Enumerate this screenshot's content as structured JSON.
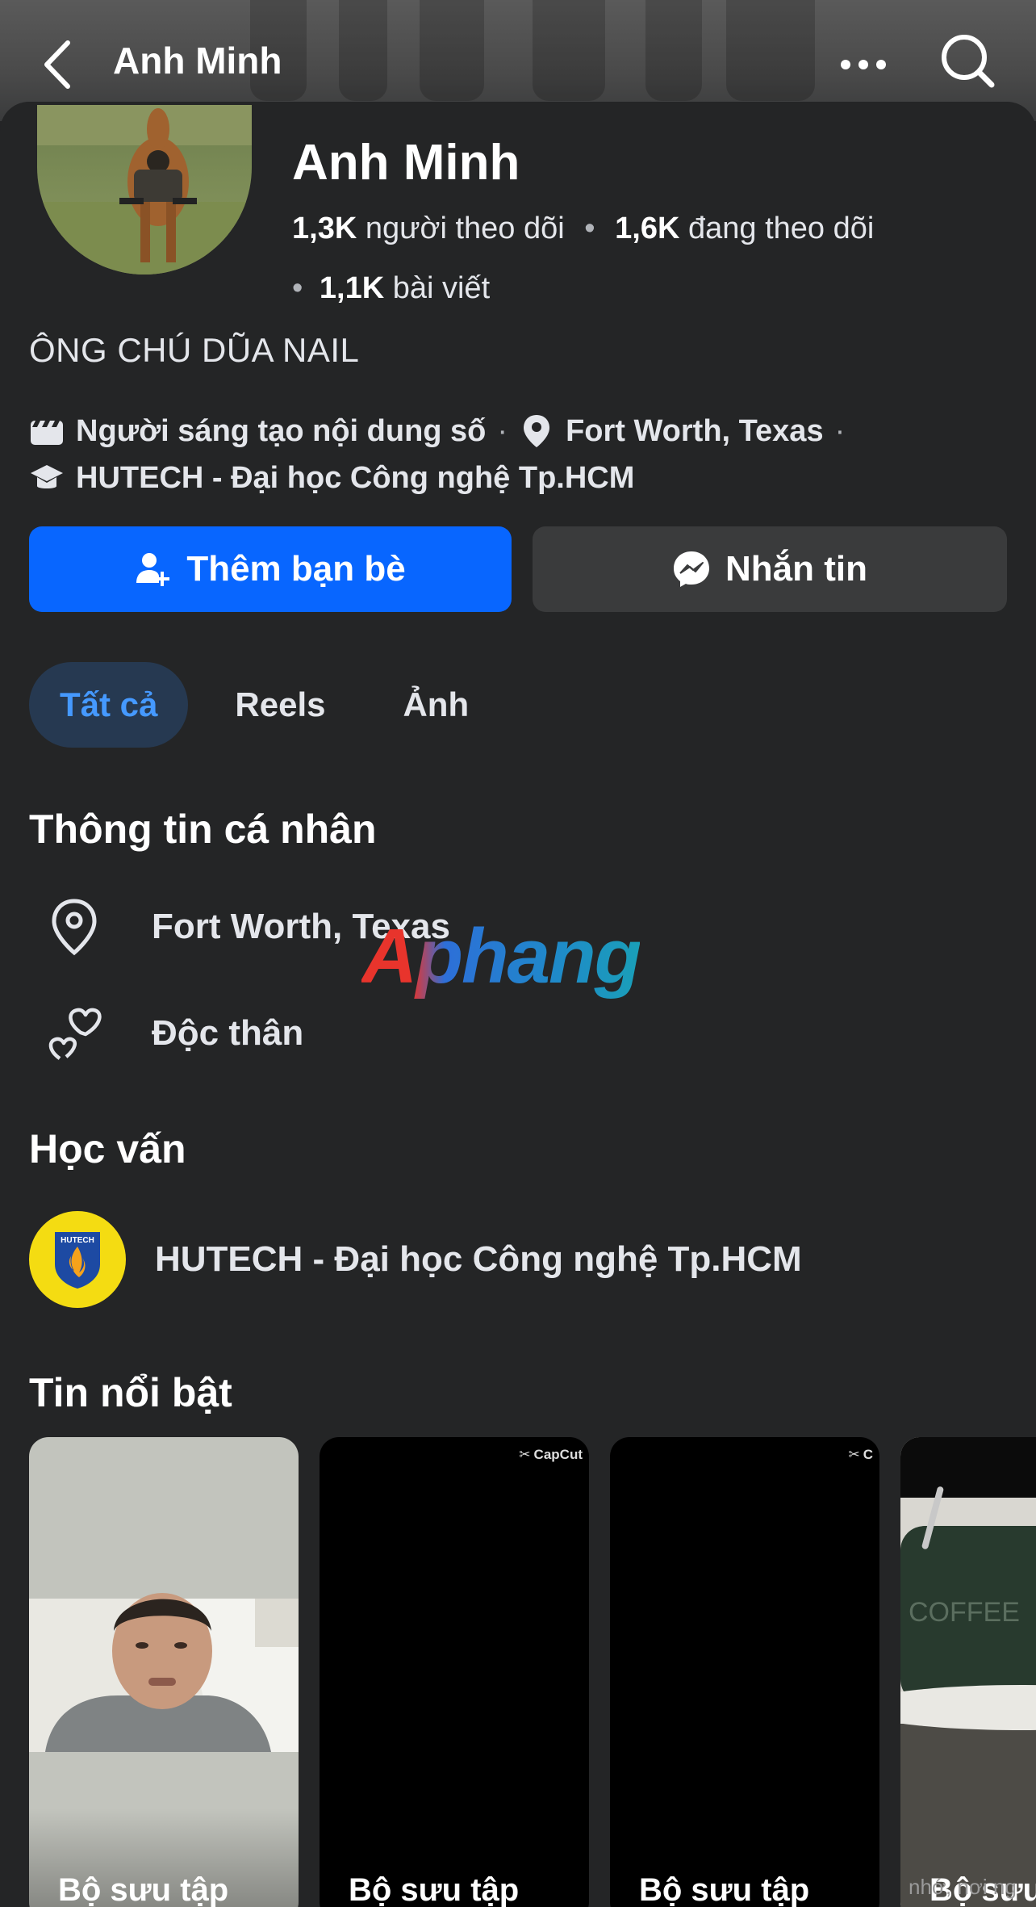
{
  "header": {
    "title": "Anh Minh",
    "back_icon": "chevron-left-icon",
    "more_icon": "more-horizontal-icon",
    "search_icon": "search-icon"
  },
  "profile": {
    "name": "Anh Minh",
    "followers_count": "1,3K",
    "followers_label": "người theo dõi",
    "following_count": "1,6K",
    "following_label": "đang theo dõi",
    "posts_count": "1,1K",
    "posts_label": "bài viết",
    "bio": "ÔNG CHÚ DŨA NAIL",
    "category": "Người sáng tạo nội dung số",
    "location": "Fort Worth, Texas",
    "school": "HUTECH - Đại học Công nghệ Tp.HCM"
  },
  "actions": {
    "add_friend_label": "Thêm bạn bè",
    "message_label": "Nhắn tin"
  },
  "tabs": [
    {
      "label": "Tất cả",
      "active": true
    },
    {
      "label": "Reels",
      "active": false
    },
    {
      "label": "Ảnh",
      "active": false
    }
  ],
  "personal_info": {
    "title": "Thông tin cá nhân",
    "location": "Fort Worth, Texas",
    "relationship": "Độc thân"
  },
  "education": {
    "title": "Học vấn",
    "school": "HUTECH - Đại học Công nghệ Tp.HCM",
    "logo_text": "HUTECH"
  },
  "highlights": {
    "title": "Tin nổi bật",
    "items": [
      {
        "label": "Bộ sưu tập"
      },
      {
        "label": "Bộ sưu tập",
        "badge": "CapCut"
      },
      {
        "label": "Bộ sưu tập",
        "badge": "C"
      },
      {
        "label": "Bộ sưu tập"
      }
    ],
    "coffee_text": "COFFEE"
  },
  "watermark": "Aphang",
  "corner_text": "nhớ, nơi ng",
  "colors": {
    "background": "#242526",
    "primary_button": "#0866ff",
    "secondary_button": "#3a3b3c",
    "active_tab_bg": "#263951",
    "active_tab_text": "#4599ff"
  }
}
